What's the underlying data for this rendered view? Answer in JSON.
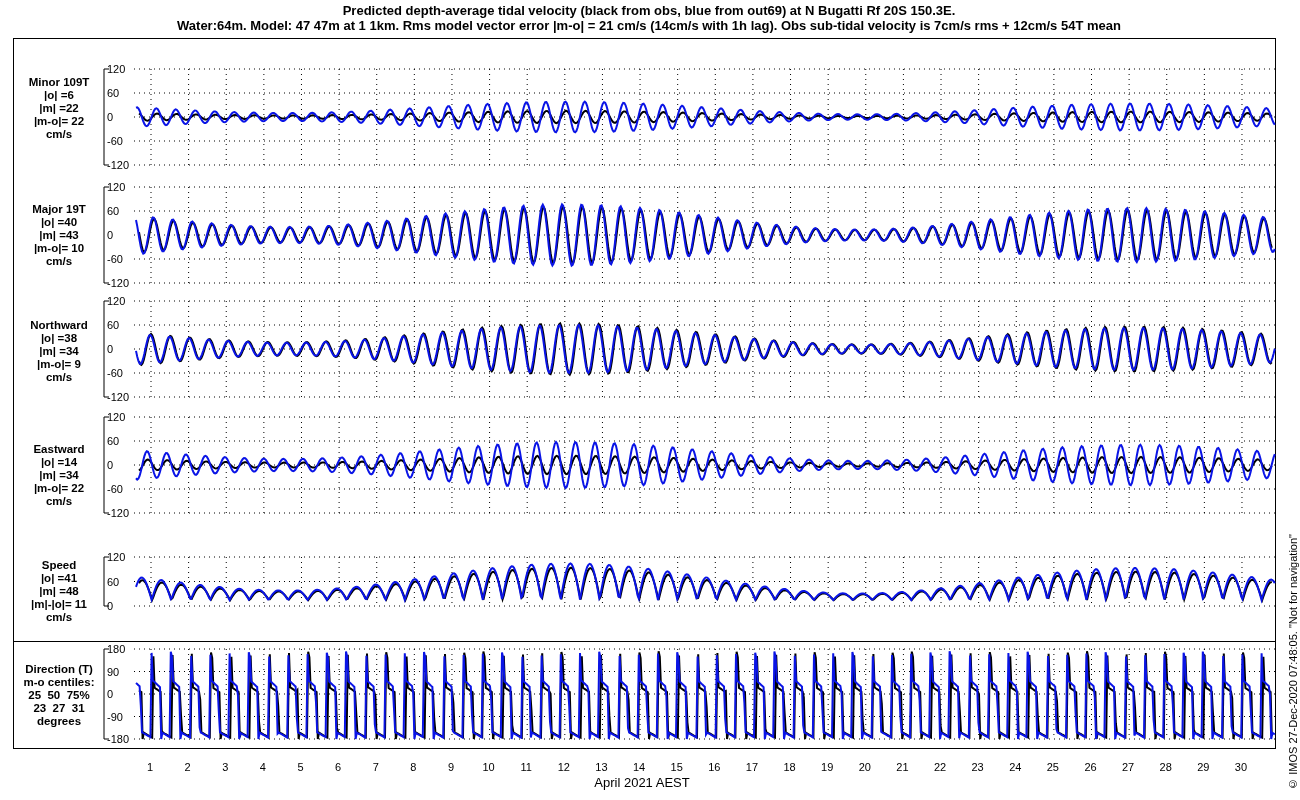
{
  "title": "Predicted depth-average tidal velocity (black from obs, blue from out69) at N Bugatti Rf 20S 150.3E.",
  "subtitle": "Water:64m. Model: 47 47m at 1 1km. Rms model vector error |m-o| = 21 cm/s (14cm/s with 1h lag). Obs sub-tidal velocity is 7cm/s rms + 12cm/s 54T mean",
  "panels": [
    {
      "kind": "velocity",
      "label_lines": [
        "Minor 109T",
        "|o| =6",
        "|m| =22",
        "|m-o|= 22",
        "cm/s"
      ],
      "yticks": [
        "120",
        "60",
        "0",
        "-60",
        "-120"
      ]
    },
    {
      "kind": "velocity",
      "label_lines": [
        "Major 19T",
        "|o| =40",
        "|m| =43",
        "|m-o|= 10",
        "cm/s"
      ],
      "yticks": [
        "120",
        "60",
        "0",
        "-60",
        "-120"
      ]
    },
    {
      "kind": "velocity",
      "label_lines": [
        "Northward",
        "|o| =38",
        "|m| =34",
        "|m-o|= 9",
        "cm/s"
      ],
      "yticks": [
        "120",
        "60",
        "0",
        "-60",
        "-120"
      ]
    },
    {
      "kind": "velocity",
      "label_lines": [
        "Eastward",
        "|o| =14",
        "|m| =34",
        "|m-o|= 22",
        "cm/s"
      ],
      "yticks": [
        "120",
        "60",
        "0",
        "-60",
        "-120"
      ]
    },
    {
      "kind": "speed",
      "label_lines": [
        "Speed",
        "|o| =41",
        "|m| =48",
        "|m|-|o|= 11",
        "cm/s"
      ],
      "yticks": [
        "120",
        "60",
        "0"
      ]
    },
    {
      "kind": "direction",
      "label_lines": [
        "Direction (T)",
        "m-o centiles:",
        "25  50  75%",
        "23  27  31",
        "degrees"
      ],
      "yticks": [
        "180",
        "90",
        "0",
        "-90",
        "-180"
      ]
    }
  ],
  "days": [
    "1",
    "2",
    "3",
    "4",
    "5",
    "6",
    "7",
    "8",
    "9",
    "10",
    "11",
    "12",
    "13",
    "14",
    "15",
    "16",
    "17",
    "18",
    "19",
    "20",
    "21",
    "22",
    "23",
    "24",
    "25",
    "26",
    "27",
    "28",
    "29",
    "30"
  ],
  "xlabel": "April 2021 AEST",
  "footer_note": "© IMOS 27-Dec-2020 07:48:05. \"Not for navigation\""
}
